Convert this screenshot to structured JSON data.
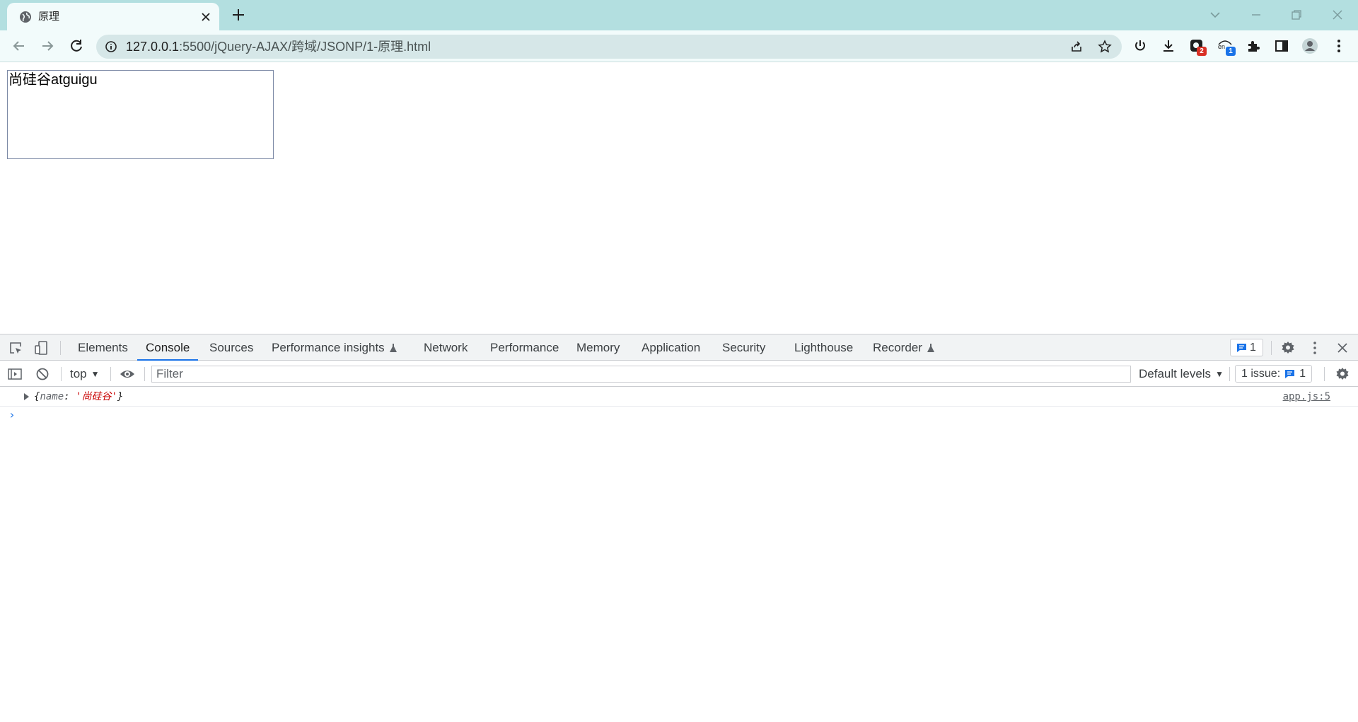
{
  "browser": {
    "tab": {
      "title": "原理",
      "favicon": "globe-icon"
    },
    "address": {
      "host": "127.0.0.1",
      "path": ":5500/jQuery-AJAX/跨域/JSONP/1-原理.html"
    },
    "extension_badges": {
      "ext1": "2",
      "ext2": "1"
    },
    "ext2_label": "en",
    "colors": {
      "tabstrip": "#b3dfe0",
      "toolbar": "#f2fbfb",
      "omnibox": "#d6e7e8"
    }
  },
  "page": {
    "box_text": "尚硅谷atguigu"
  },
  "devtools": {
    "tabs": [
      {
        "label": "Elements"
      },
      {
        "label": "Console"
      },
      {
        "label": "Sources"
      },
      {
        "label": "Performance insights"
      },
      {
        "label": "Network"
      },
      {
        "label": "Performance"
      },
      {
        "label": "Memory"
      },
      {
        "label": "Application"
      },
      {
        "label": "Security"
      },
      {
        "label": "Lighthouse"
      },
      {
        "label": "Recorder"
      }
    ],
    "active_tab": "Console",
    "messages_count": "1",
    "console": {
      "context": "top",
      "filter_placeholder": "Filter",
      "levels": "Default levels",
      "issues_label": "1 issue:",
      "issues_count": "1",
      "log": {
        "open": "{",
        "key": "name",
        "sep": ": ",
        "value": "'尚硅谷'",
        "close": "}",
        "source": "app.js:5"
      },
      "prompt": "›"
    }
  }
}
